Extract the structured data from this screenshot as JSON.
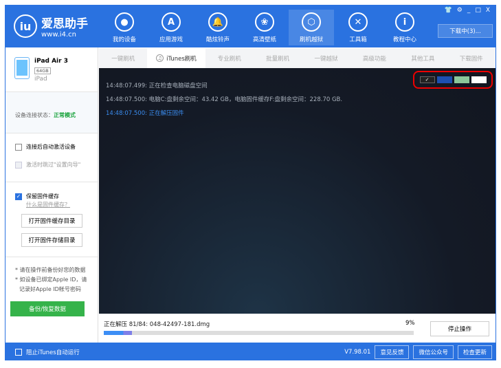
{
  "header": {
    "logo_icon": "iu",
    "brand": "爱思助手",
    "url": "www.i4.cn",
    "nav": [
      {
        "label": "我的设备",
        "icon": ""
      },
      {
        "label": "应用游戏",
        "icon": "A"
      },
      {
        "label": "酷炫铃声",
        "icon": "🔔"
      },
      {
        "label": "高清壁纸",
        "icon": "❀"
      },
      {
        "label": "刷机越狱",
        "icon": "⬡"
      },
      {
        "label": "工具箱",
        "icon": "✕"
      },
      {
        "label": "教程中心",
        "icon": "i"
      }
    ],
    "window_controls": [
      "👕",
      "⚙",
      "_",
      "□",
      "X"
    ],
    "download": "下载中(3)..."
  },
  "device": {
    "name": "iPad Air 3",
    "capacity": "64GB",
    "type": "iPad"
  },
  "status": {
    "label": "设备连接状态：",
    "value": "正常模式"
  },
  "options": {
    "auto_activate": "连接后自动激活设备",
    "skip_setup": "激活时跳过\"设置向导\""
  },
  "firmware": {
    "keep_cache": "保留固件缓存",
    "what_is": "什么是固件缓存？",
    "open_cache": "打开固件缓存目录",
    "open_storage": "打开固件存储目录"
  },
  "notes": [
    "* 请在操作前备份好您的数据",
    "* 如设备已绑定Apple ID，请",
    "记录好Apple ID帐号密码"
  ],
  "backup_button": "备份/恢复数据",
  "tabs": [
    "一键刷机",
    "iTunes刷机",
    "专业刷机",
    "批量刷机",
    "一键越狱",
    "高级功能",
    "其他工具",
    "下载固件"
  ],
  "log": [
    {
      "time": "14:48:07.499:",
      "msg": "正在检查电脑磁盘空间"
    },
    {
      "time": "14:48:07.500:",
      "msg": "电脑C:盘剩余空间：43.42 GB，电脑固件缓存F:盘剩余空间：228.70 GB."
    },
    {
      "time": "14:48:07.500:",
      "msg": "正在解压固件"
    }
  ],
  "themes": {
    "colors": [
      "#222222",
      "#1d4fb0",
      "#8cc79a",
      "#ffffff"
    ],
    "check": "✓"
  },
  "progress": {
    "text": "正在解压 81/84: 048-42497-181.dmg",
    "percent_label": "9%",
    "percent": 9,
    "stop": "停止操作"
  },
  "footer": {
    "block_itunes": "阻止iTunes自动运行",
    "version": "V7.98.01",
    "feedback": "意见反馈",
    "wechat": "微信公众号",
    "update": "检查更新"
  }
}
